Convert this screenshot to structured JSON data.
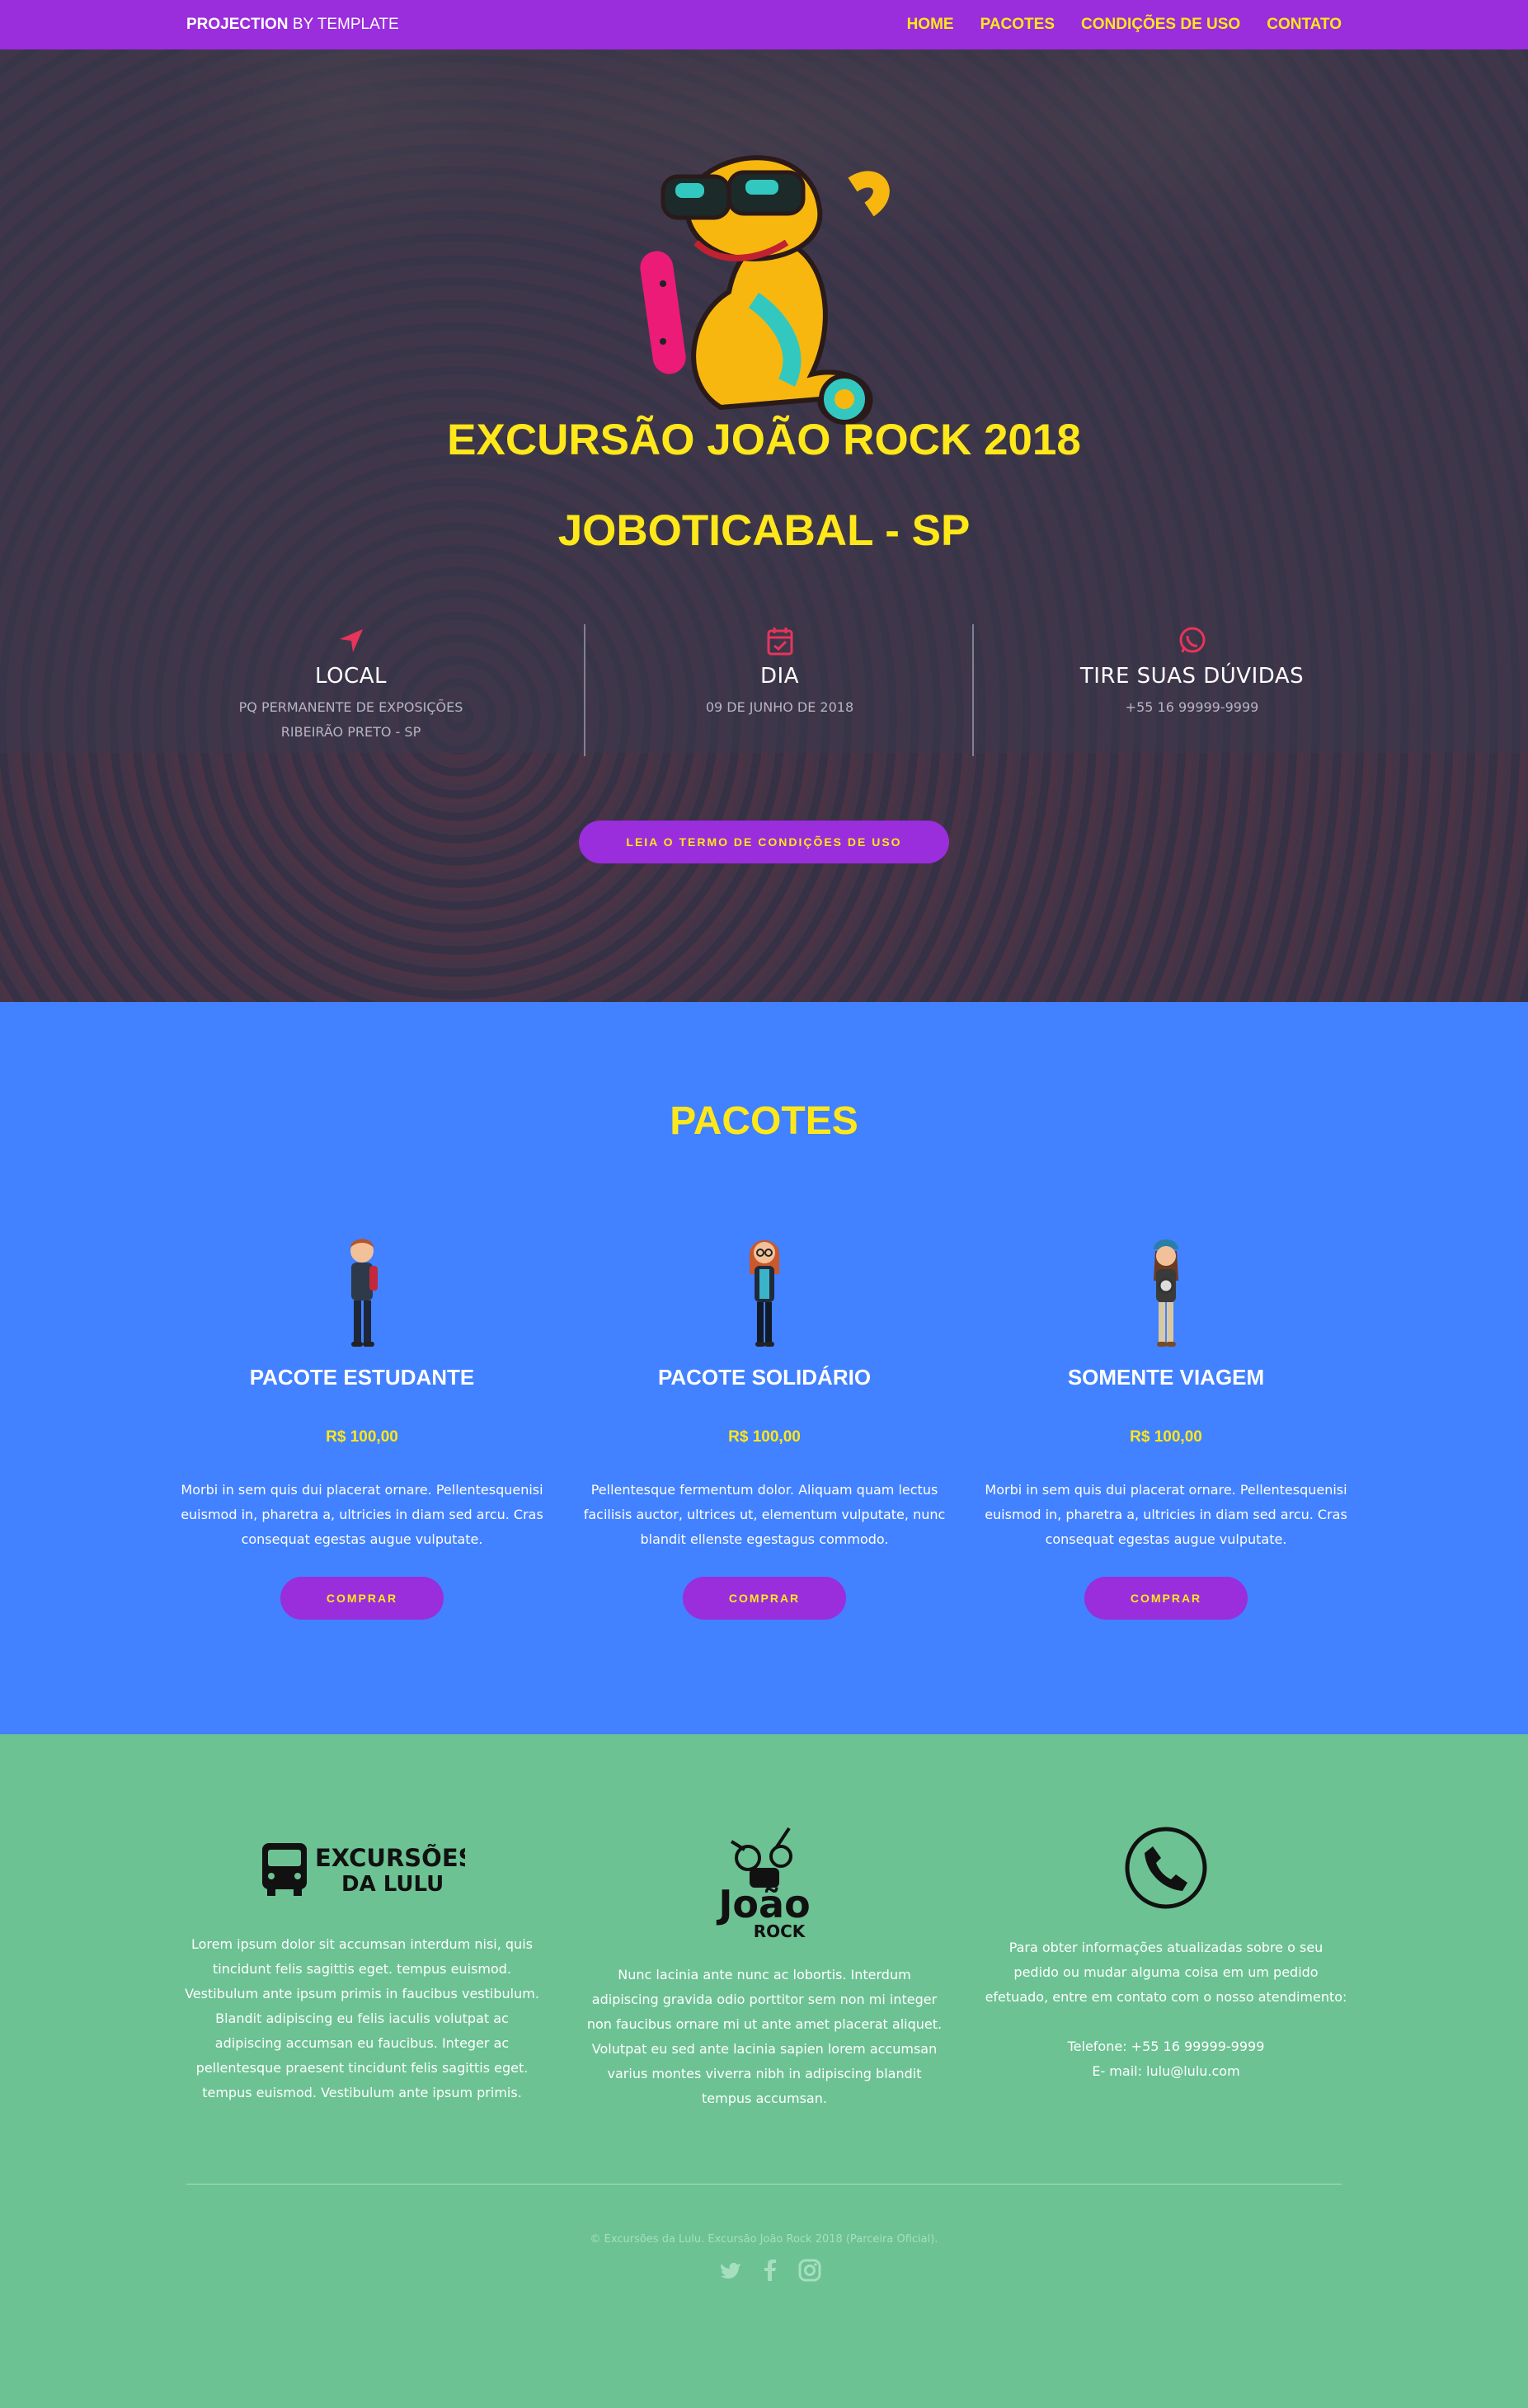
{
  "nav": {
    "brand_bold": "PROJECTION",
    "brand_rest": "BY TEMPLATE",
    "links": [
      "HOME",
      "PACOTES",
      "CONDIÇÕES DE USO",
      "CONTATO"
    ]
  },
  "hero": {
    "title": "EXCURSÃO JOÃO ROCK 2018",
    "subtitle": "JOBOTICABAL - SP",
    "info": [
      {
        "icon": "location-arrow-icon",
        "label": "LOCAL",
        "lines": [
          "PQ PERMANENTE DE EXPOSIÇÕES",
          "RIBEIRÃO PRETO - SP"
        ]
      },
      {
        "icon": "calendar-check-icon",
        "label": "DIA",
        "lines": [
          "09 DE JUNHO DE 2018"
        ]
      },
      {
        "icon": "whatsapp-icon",
        "label": "TIRE SUAS DÚVIDAS",
        "lines": [
          "+55 16 99999-9999"
        ]
      }
    ],
    "cta": "LEIA O TERMO DE CONDIÇÕES DE USO"
  },
  "pacotes": {
    "title": "PACOTES",
    "cards": [
      {
        "name": "PACOTE ESTUDANTE",
        "price": "R$ 100,00",
        "desc": "Morbi in sem quis dui placerat ornare. Pellentesquenisi euismod in, pharetra a, ultricies in diam sed arcu. Cras consequat egestas augue vulputate.",
        "button": "COMPRAR"
      },
      {
        "name": "PACOTE SOLIDÁRIO",
        "price": "R$ 100,00",
        "desc": "Pellentesque fermentum dolor. Aliquam quam lectus facilisis auctor, ultrices ut, elementum vulputate, nunc blandit ellenste egestagus commodo.",
        "button": "COMPRAR"
      },
      {
        "name": "SOMENTE VIAGEM",
        "price": "R$ 100,00",
        "desc": "Morbi in sem quis dui placerat ornare. Pellentesquenisi euismod in, pharetra a, ultricies in diam sed arcu. Cras consequat egestas augue vulputate.",
        "button": "COMPRAR"
      }
    ]
  },
  "footer": {
    "logo1": {
      "line1": "EXCURSÕES",
      "line2": "DA LULU"
    },
    "logo2": {
      "line1": "João",
      "line2": "ROCK"
    },
    "col1": "Lorem ipsum dolor sit accumsan interdum nisi, quis tincidunt felis sagittis eget. tempus euismod. Vestibulum ante ipsum primis in faucibus vestibulum. Blandit adipiscing eu felis iaculis volutpat ac adipiscing accumsan eu faucibus. Integer ac pellentesque praesent tincidunt felis sagittis eget. tempus euismod. Vestibulum ante ipsum primis.",
    "col2": "Nunc lacinia ante nunc ac lobortis. Interdum adipiscing gravida odio porttitor sem non mi integer non faucibus ornare mi ut ante amet placerat aliquet. Volutpat eu sed ante lacinia sapien lorem accumsan varius montes viverra nibh in adipiscing blandit tempus accumsan.",
    "col3": "Para obter informações atualizadas sobre o seu pedido ou mudar alguma coisa em um pedido efetuado, entre em contato com o nosso atendimento:",
    "phone": "Telefone: +55 16 99999-9999",
    "email": "E- mail: lulu@lulu.com",
    "copyright": "© Excursões da Lulu. Excursão João Rock 2018 (Parceira Oficial).",
    "socials": [
      "twitter-icon",
      "facebook-icon",
      "instagram-icon"
    ]
  },
  "colors": {
    "nav": "#9a2ddc",
    "accent_yellow": "#ffe81a",
    "pacotes_bg": "#4281ff",
    "footer_bg": "#6cc293",
    "icon_red": "#e8345a"
  }
}
